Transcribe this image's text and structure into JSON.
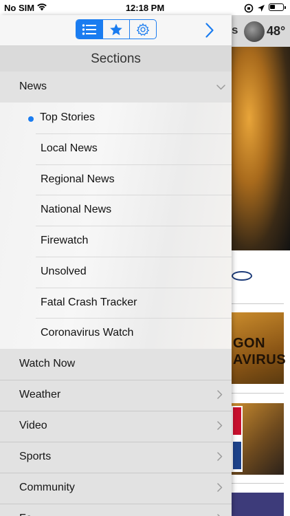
{
  "status_bar": {
    "carrier": "No SIM",
    "time": "12:18 PM"
  },
  "background": {
    "header_fragment": "s",
    "temperature": "48°",
    "card_text_line1": "GON",
    "card_text_line2": "AVIRUS"
  },
  "drawer": {
    "tabs": [
      {
        "icon": "list-icon",
        "active": true
      },
      {
        "icon": "star-icon",
        "active": false
      },
      {
        "icon": "gear-icon",
        "active": false
      }
    ],
    "sections_title": "Sections",
    "news": {
      "label": "News",
      "expanded": true,
      "items": [
        {
          "label": "Top Stories",
          "selected": true
        },
        {
          "label": "Local News"
        },
        {
          "label": "Regional News"
        },
        {
          "label": "National News"
        },
        {
          "label": "Firewatch"
        },
        {
          "label": "Unsolved"
        },
        {
          "label": "Fatal Crash Tracker"
        },
        {
          "label": "Coronavirus Watch"
        }
      ]
    },
    "items": [
      {
        "label": "Watch Now",
        "has_chevron": false
      },
      {
        "label": "Weather",
        "has_chevron": true
      },
      {
        "label": "Video",
        "has_chevron": true
      },
      {
        "label": "Sports",
        "has_chevron": true
      },
      {
        "label": "Community",
        "has_chevron": true
      },
      {
        "label": "Fe",
        "has_chevron": true
      }
    ]
  },
  "colors": {
    "accent": "#1a7cf0"
  }
}
